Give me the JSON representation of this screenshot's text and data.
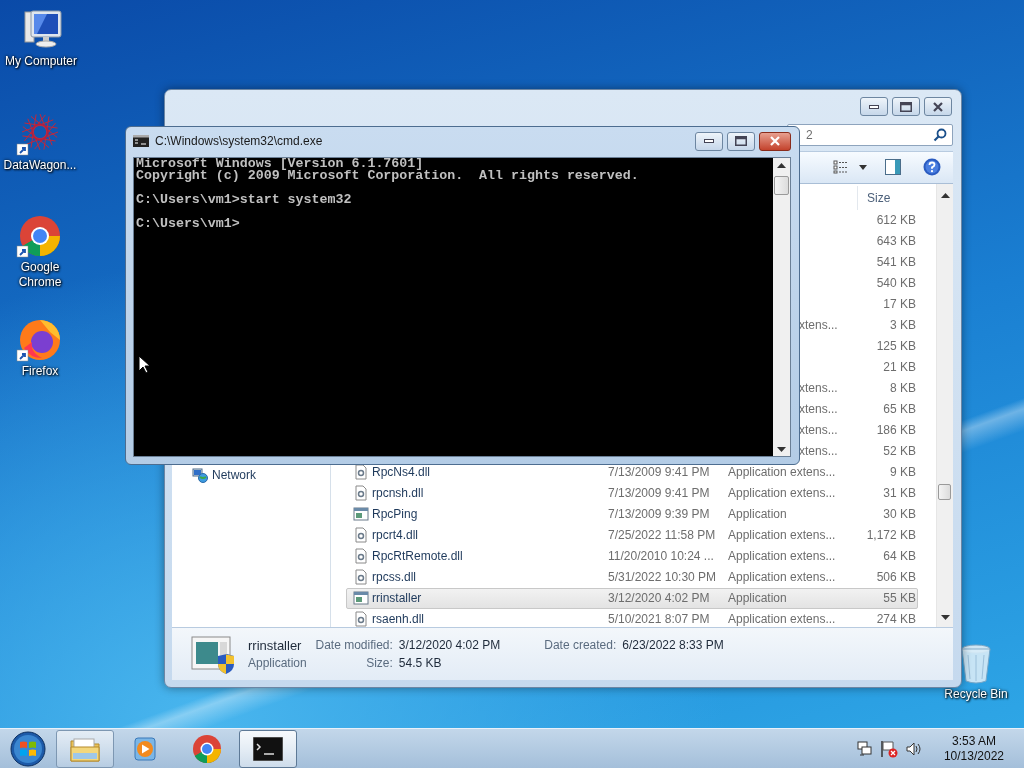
{
  "desktop_icons": [
    {
      "label": "My Computer",
      "kind": "computer",
      "shortcut": false
    },
    {
      "label": "DataWagon...",
      "kind": "starburst",
      "shortcut": true
    },
    {
      "label": "Google Chrome",
      "kind": "chrome",
      "shortcut": true
    },
    {
      "label": "Firefox",
      "kind": "firefox",
      "shortcut": true
    }
  ],
  "recycle_bin": {
    "label": "Recycle Bin"
  },
  "explorer": {
    "search": {
      "placeholder": "2"
    },
    "columns": [
      {
        "label": "Size"
      }
    ],
    "nav_items": [
      {
        "label": "Network"
      }
    ],
    "rows": [
      {
        "size": "612 KB",
        "selected": false
      },
      {
        "size": "643 KB",
        "selected": false
      },
      {
        "size": "541 KB",
        "selected": false
      },
      {
        "size": "540 KB",
        "selected": false
      },
      {
        "size": "17 KB",
        "selected": false
      },
      {
        "type": "xtens...",
        "size": "3 KB",
        "selected": false
      },
      {
        "size": "125 KB",
        "selected": false
      },
      {
        "size": "21 KB",
        "selected": false
      },
      {
        "type": "xtens...",
        "size": "8 KB",
        "selected": false
      },
      {
        "type": "xtens...",
        "size": "65 KB",
        "selected": false
      },
      {
        "type": "xtens...",
        "size": "186 KB",
        "selected": false
      },
      {
        "type": "xtens...",
        "size": "52 KB",
        "selected": false
      },
      {
        "kind": "dll",
        "name": "RpcNs4.dll",
        "date": "7/13/2009 9:41 PM",
        "type": "Application extens...",
        "size": "9 KB",
        "selected": false
      },
      {
        "kind": "dll",
        "name": "rpcnsh.dll",
        "date": "7/13/2009 9:41 PM",
        "type": "Application extens...",
        "size": "31 KB",
        "selected": false
      },
      {
        "kind": "app",
        "name": "RpcPing",
        "date": "7/13/2009 9:39 PM",
        "type": "Application",
        "size": "30 KB",
        "selected": false
      },
      {
        "kind": "dll",
        "name": "rpcrt4.dll",
        "date": "7/25/2022 11:58 PM",
        "type": "Application extens...",
        "size": "1,172 KB",
        "selected": false
      },
      {
        "kind": "dll",
        "name": "RpcRtRemote.dll",
        "date": "11/20/2010 10:24 ...",
        "type": "Application extens...",
        "size": "64 KB",
        "selected": false
      },
      {
        "kind": "dll",
        "name": "rpcss.dll",
        "date": "5/31/2022 10:30 PM",
        "type": "Application extens...",
        "size": "506 KB",
        "selected": false
      },
      {
        "kind": "app",
        "name": "rrinstaller",
        "date": "3/12/2020 4:02 PM",
        "type": "Application",
        "size": "55 KB",
        "selected": true
      },
      {
        "kind": "dll",
        "name": "rsaenh.dll",
        "date": "5/10/2021 8:07 PM",
        "type": "Application extens...",
        "size": "274 KB",
        "selected": false
      }
    ],
    "details": {
      "name": "rrinstaller",
      "type": "Application",
      "fields": [
        {
          "label": "Date modified:",
          "value": "3/12/2020 4:02 PM"
        },
        {
          "label": "Date created:",
          "value": "6/23/2022 8:33 PM"
        },
        {
          "label": "Size:",
          "value": "54.5 KB"
        }
      ]
    }
  },
  "cmd": {
    "title": "C:\\Windows\\system32\\cmd.exe",
    "blocks": [
      [
        "Microsoft Windows [Version 6.1.7601]",
        "Copyright (c) 2009 Microsoft Corporation.  All rights reserved."
      ],
      [
        "C:\\Users\\vm1>start system32"
      ],
      [
        "C:\\Users\\vm1>"
      ]
    ]
  },
  "taskbar": {
    "buttons": [
      {
        "kind": "folder",
        "open": true,
        "selected": false
      },
      {
        "kind": "media",
        "open": false,
        "selected": false
      },
      {
        "kind": "chrome",
        "open": false,
        "selected": false
      },
      {
        "kind": "terminal",
        "open": true,
        "selected": true
      }
    ],
    "tray_icons": [
      {
        "kind": "network"
      },
      {
        "kind": "flag"
      },
      {
        "kind": "speaker"
      }
    ],
    "clock": {
      "time": "3:53 AM",
      "date": "10/13/2022"
    }
  }
}
